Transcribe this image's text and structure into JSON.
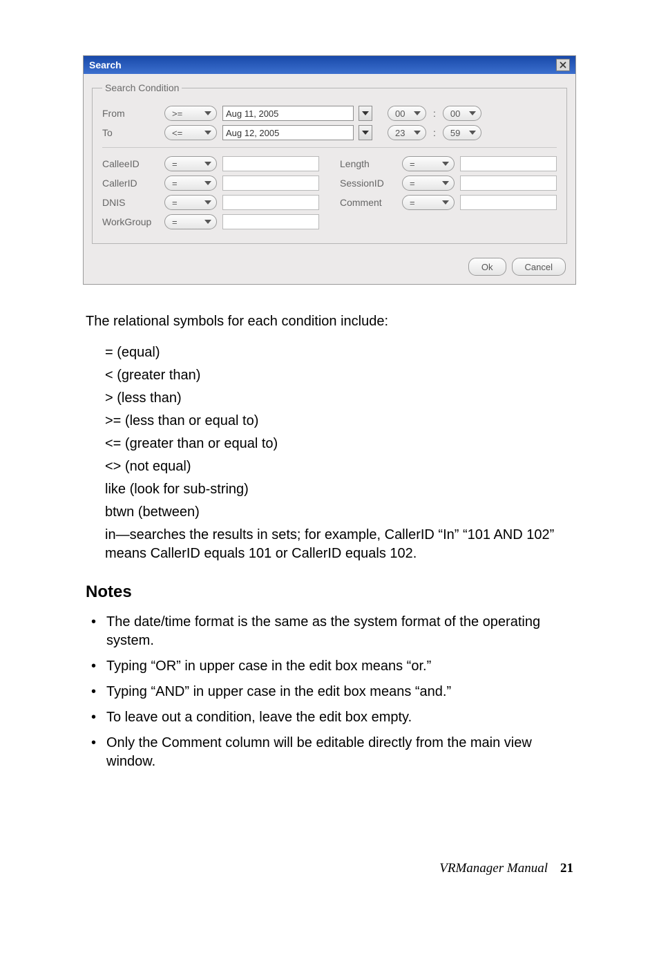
{
  "dialog": {
    "title": "Search",
    "fieldset_legend": "Search Condition",
    "from": {
      "label": "From",
      "op": ">=",
      "date": "Aug 11, 2005",
      "hour": "00",
      "minute": "00"
    },
    "to": {
      "label": "To",
      "op": "<=",
      "date": "Aug 12, 2005",
      "hour": "23",
      "minute": "59"
    },
    "left_fields": [
      {
        "label": "CalleeID",
        "op": "="
      },
      {
        "label": "CallerID",
        "op": "="
      },
      {
        "label": "DNIS",
        "op": "="
      },
      {
        "label": "WorkGroup",
        "op": "="
      }
    ],
    "right_fields": [
      {
        "label": "Length",
        "op": "="
      },
      {
        "label": "SessionID",
        "op": "="
      },
      {
        "label": "Comment",
        "op": "="
      }
    ],
    "buttons": {
      "ok": "Ok",
      "cancel": "Cancel"
    }
  },
  "intro": "The relational symbols for each condition include:",
  "symbols": [
    "= (equal)",
    "< (greater than)",
    "> (less than)",
    ">= (less than or equal to)",
    "<= (greater than or equal to)",
    "<> (not equal)",
    "like (look for sub-string)",
    "btwn (between)",
    "in—searches the results in sets; for example, CallerID “In” “101 AND 102” means CallerID equals 101 or CallerID equals 102."
  ],
  "notes_heading": "Notes",
  "notes": [
    "The date/time format is the same as the system format of the operating system.",
    "Typing “OR” in upper case in the edit box means “or.”",
    "Typing “AND” in upper case in the edit box means “and.”",
    "To leave out a condition, leave the edit box empty.",
    "Only the Comment column will be editable directly from the main view window."
  ],
  "footer": {
    "title": "VRManager Manual",
    "page": "21"
  }
}
